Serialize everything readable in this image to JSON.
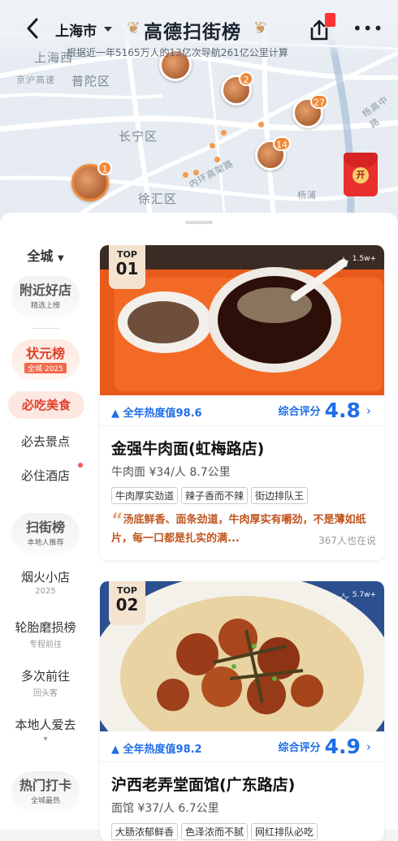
{
  "header": {
    "city": "上海市",
    "brand": "高德扫街榜",
    "subtitle": "根据近一年5165万人的13亿次导航261亿公里计算"
  },
  "map": {
    "labels": [
      "上海西",
      "京沪高速",
      "普陀区",
      "长宁区",
      "徐汇区",
      "内环高架路",
      "杨高中路",
      "杨浦"
    ],
    "markers": [
      {
        "rank": "1"
      },
      {
        "rank": "2"
      },
      {
        "rank": "14"
      },
      {
        "rank": "27"
      }
    ],
    "red_packet_button": "开"
  },
  "sidebar": {
    "all_city": "全城",
    "nearby": {
      "title": "附近好店",
      "sub": "精选上榜"
    },
    "champion": {
      "title": "状元榜",
      "sub": "全城·2025"
    },
    "items": [
      "必吃美食",
      "必去景点",
      "必住酒店"
    ],
    "street": {
      "title": "扫街榜",
      "sub": "本地人推荐"
    },
    "cats": [
      {
        "title": "烟火小店",
        "sub": "2025"
      },
      {
        "title": "轮胎磨损榜",
        "sub": "专程前往"
      },
      {
        "title": "多次前往",
        "sub": "回头客"
      },
      {
        "title": "本地人爱去",
        "sub": "▾"
      }
    ],
    "hot": {
      "title": "热门打卡",
      "sub": "全城最热"
    }
  },
  "cards": [
    {
      "top_label": "TOP",
      "rank": "01",
      "heat_count": "1.5w+",
      "heat": "全年热度值98.6",
      "rating_label": "综合评分",
      "rating": "4.8",
      "name": "金强牛肉面(虹梅路店)",
      "meta": "牛肉面  ¥34/人  8.7公里",
      "tags": [
        "牛肉厚实劲道",
        "辣子香而不辣",
        "街边排队王"
      ],
      "quote": "汤底鲜香、面条劲道，牛肉厚实有嚼劲，不是薄如纸片，每一口都是扎实的满...",
      "people": "367人也在说"
    },
    {
      "top_label": "TOP",
      "rank": "02",
      "heat_count": "5.7w+",
      "heat": "全年热度值98.2",
      "rating_label": "综合评分",
      "rating": "4.9",
      "name": "沪西老弄堂面馆(广东路店)",
      "meta": "面馆  ¥37/人  6.7公里",
      "tags": [
        "大肠浓郁鲜香",
        "色泽浓而不腻",
        "网红排队必吃"
      ]
    }
  ]
}
